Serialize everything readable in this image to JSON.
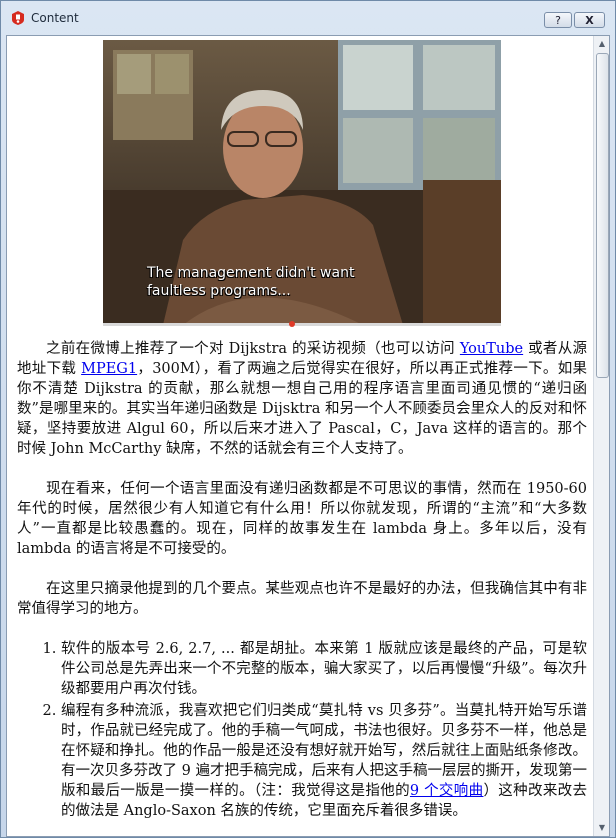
{
  "window": {
    "title": "Content",
    "help_label": "?",
    "close_label": "X",
    "app_icon": "app-logo-icon",
    "accent_color": "#d62b1f"
  },
  "video": {
    "subtitle": "The management didn't want\nfaultless programs..."
  },
  "article": {
    "p1": {
      "before_youtube": "之前在微博上推荐了一个对 Dijkstra 的采访视频（也可以访问 ",
      "youtube_link": "YouTube",
      "between": " 或者从源地址下载 ",
      "mpeg_link": "MPEG1",
      "after": "，300M），看了两遍之后觉得实在很好，所以再正式推荐一下。如果你不清楚 Dijkstra 的贡献，那么就想一想自己用的程序语言里面司通见惯的“递归函数”是哪里来的。其实当年递归函数是 Dijsktra 和另一个人不顾委员会里众人的反对和怀疑，坚持要放进 Algul 60，所以后来才进入了 Pascal，C，Java 这样的语言的。那个时候 John McCarthy 缺席，不然的话就会有三个人支持了。"
    },
    "p2": "现在看来，任何一个语言里面没有递归函数都是不可思议的事情，然而在 1950-60 年代的时候，居然很少有人知道它有什么用！所以你就发现，所谓的“主流”和“大多数人”一直都是比较愚蠢的。现在，同样的故事发生在 lambda 身上。多年以后，没有 lambda 的语言将是不可接受的。",
    "p3": "在这里只摘录他提到的几个要点。某些观点也许不是最好的办法，但我确信其中有非常值得学习的地方。",
    "list": {
      "item1": "软件的版本号 2.6, 2.7, ... 都是胡扯。本来第 1 版就应该是最终的产品，可是软件公司总是先弄出来一个不完整的版本，骗大家买了，以后再慢慢“升级”。每次升级都要用户再次付钱。",
      "item2_before": "编程有多种流派，我喜欢把它们归类成“莫扎特 vs 贝多芬”。当莫扎特开始写乐谱时，作品就已经完成了。他的手稿一气呵成，书法也很好。贝多芬不一样，他总是在怀疑和挣扎。他的作品一般是还没有想好就开始写，然后就往上面贴纸条修改。有一次贝多芬改了 9 遍才把手稿完成，后来有人把这手稿一层层的撕开，发现第一版和最后一版是一摸一样的。（注：我觉得这是指他的",
      "item2_link": "9 个交响曲",
      "item2_after": "）这种改来改去的做法是 Anglo-Saxon 名族的传统，它里面充斥着很多错误。"
    }
  }
}
